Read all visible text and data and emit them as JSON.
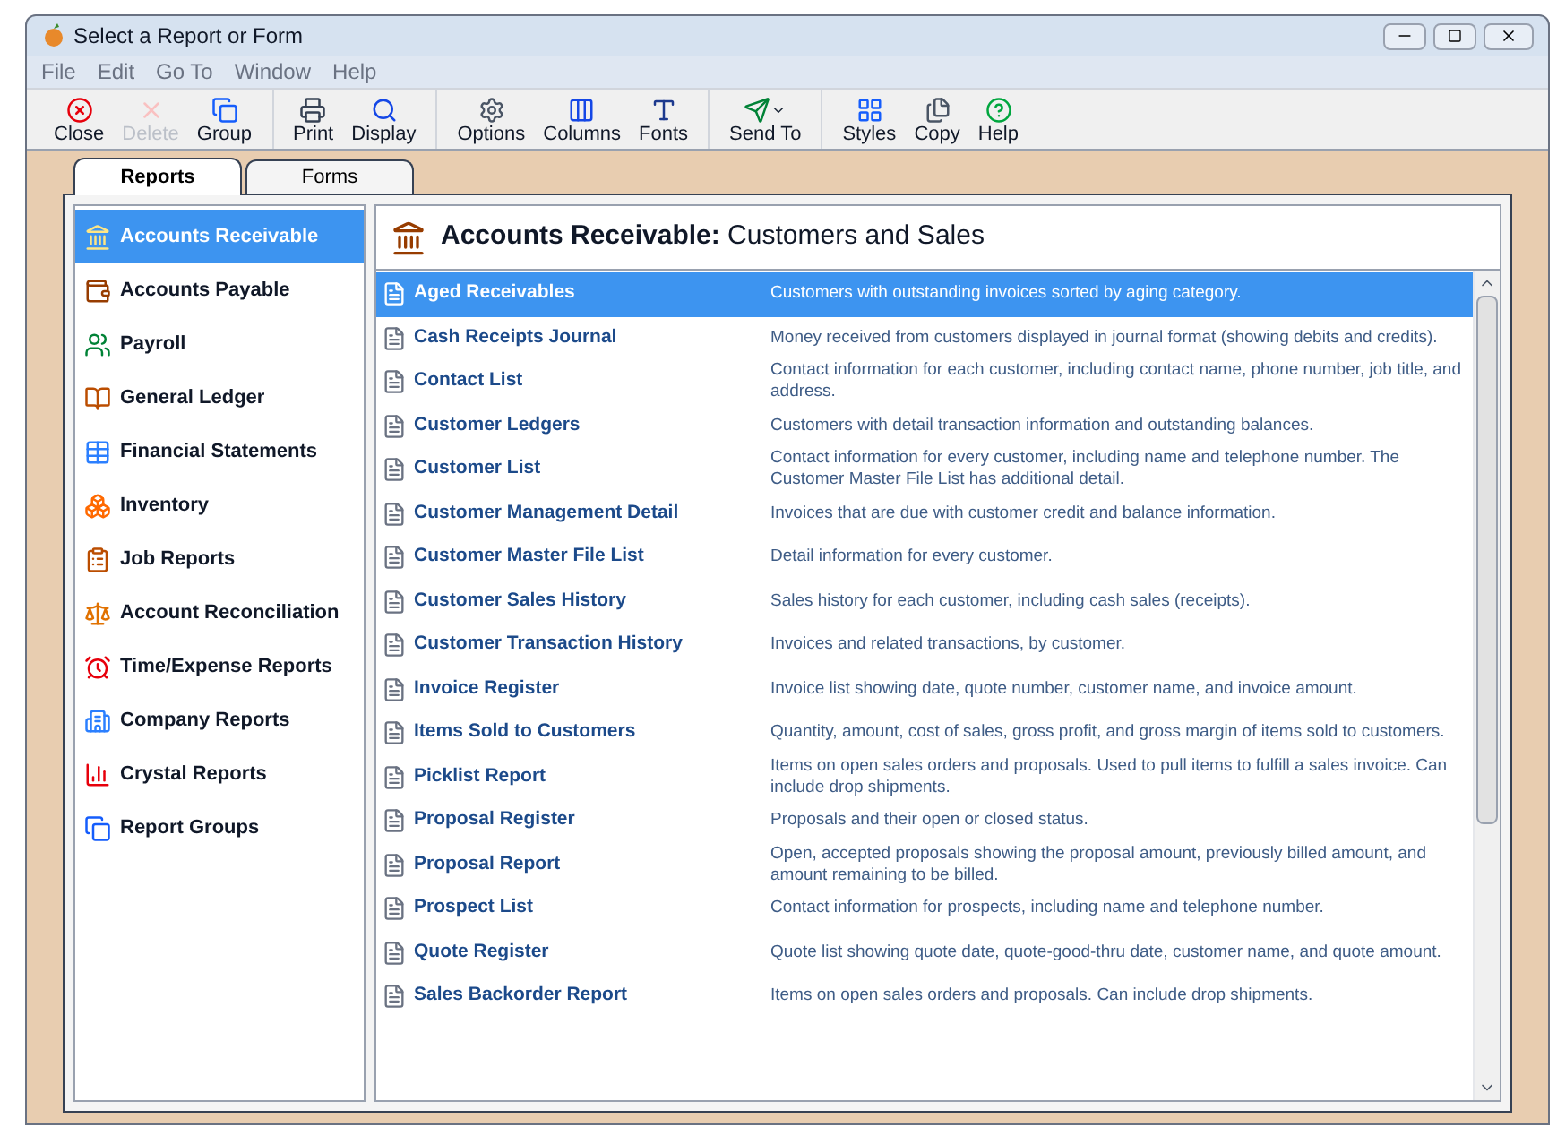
{
  "window": {
    "title": "Select a Report or Form"
  },
  "menu": [
    "File",
    "Edit",
    "Go To",
    "Window",
    "Help"
  ],
  "toolbar": [
    [
      {
        "label": "Close",
        "disabled": false,
        "dropdown": false
      },
      {
        "label": "Delete",
        "disabled": true,
        "dropdown": false
      },
      {
        "label": "Group",
        "disabled": false,
        "dropdown": false
      }
    ],
    [
      {
        "label": "Print",
        "disabled": false,
        "dropdown": false
      },
      {
        "label": "Display",
        "disabled": false,
        "dropdown": false
      }
    ],
    [
      {
        "label": "Options",
        "disabled": false,
        "dropdown": false
      },
      {
        "label": "Columns",
        "disabled": false,
        "dropdown": false
      },
      {
        "label": "Fonts",
        "disabled": false,
        "dropdown": false
      }
    ],
    [
      {
        "label": "Send To",
        "disabled": false,
        "dropdown": true
      }
    ],
    [
      {
        "label": "Styles",
        "disabled": false,
        "dropdown": false
      },
      {
        "label": "Copy",
        "disabled": false,
        "dropdown": false
      },
      {
        "label": "Help",
        "disabled": false,
        "dropdown": false
      }
    ]
  ],
  "tabs": [
    {
      "label": "Reports",
      "selected": true
    },
    {
      "label": "Forms",
      "selected": false
    }
  ],
  "sidebar": {
    "items": [
      {
        "label": "Accounts Receivable",
        "selected": true
      },
      {
        "label": "Accounts Payable",
        "selected": false
      },
      {
        "label": "Payroll",
        "selected": false
      },
      {
        "label": "General Ledger",
        "selected": false
      },
      {
        "label": "Financial Statements",
        "selected": false
      },
      {
        "label": "Inventory",
        "selected": false
      },
      {
        "label": "Job Reports",
        "selected": false
      },
      {
        "label": "Account Reconciliation",
        "selected": false
      },
      {
        "label": "Time/Expense Reports",
        "selected": false
      },
      {
        "label": "Company Reports",
        "selected": false
      },
      {
        "label": "Crystal Reports",
        "selected": false
      },
      {
        "label": "Report Groups",
        "selected": false
      }
    ]
  },
  "panel": {
    "title": "**Accounts Receivable:** Customers and Sales",
    "reports": [
      {
        "name": "Aged Receivables",
        "description": "Customers with outstanding invoices sorted by aging category.",
        "selected": true
      },
      {
        "name": "Cash Receipts Journal",
        "description": "Money received from customers displayed in journal format (showing debits and credits).",
        "selected": false
      },
      {
        "name": "Contact List",
        "description": "Contact information for each customer, including contact name, phone number, job title, and address.",
        "selected": false
      },
      {
        "name": "Customer Ledgers",
        "description": "Customers with detail transaction information and outstanding balances.",
        "selected": false
      },
      {
        "name": "Customer List",
        "description": "Contact information for every customer, including name and telephone number. The Customer Master File List has additional detail.",
        "selected": false
      },
      {
        "name": "Customer Management Detail",
        "description": "Invoices that are due with customer credit and balance information.",
        "selected": false
      },
      {
        "name": "Customer Master File List",
        "description": "Detail information for every customer.",
        "selected": false
      },
      {
        "name": "Customer Sales History",
        "description": "Sales history for each customer, including cash sales (receipts).",
        "selected": false
      },
      {
        "name": "Customer Transaction History",
        "description": "Invoices and related transactions, by customer.",
        "selected": false
      },
      {
        "name": "Invoice Register",
        "description": "Invoice list showing date, quote number, customer name, and invoice amount.",
        "selected": false
      },
      {
        "name": "Items Sold to Customers",
        "description": "Quantity, amount, cost of sales, gross profit, and gross margin of items sold to customers.",
        "selected": false
      },
      {
        "name": "Picklist Report",
        "description": "Items on open sales orders and proposals. Used to pull items to fulfill a sales invoice.  Can include drop shipments.",
        "selected": false
      },
      {
        "name": "Proposal Register",
        "description": "Proposals and their open or closed status.",
        "selected": false
      },
      {
        "name": "Proposal Report",
        "description": "Open, accepted proposals showing the proposal amount, previously billed amount, and amount remaining to be billed.",
        "selected": false
      },
      {
        "name": "Prospect List",
        "description": "Contact information for prospects, including name and telephone number.",
        "selected": false
      },
      {
        "name": "Quote Register",
        "description": "Quote list showing quote date, quote-good-thru date, customer name, and quote amount.",
        "selected": false
      },
      {
        "name": "Sales Backorder Report",
        "description": "Items on open sales orders and proposals. Can include drop shipments.",
        "selected": false
      }
    ]
  }
}
